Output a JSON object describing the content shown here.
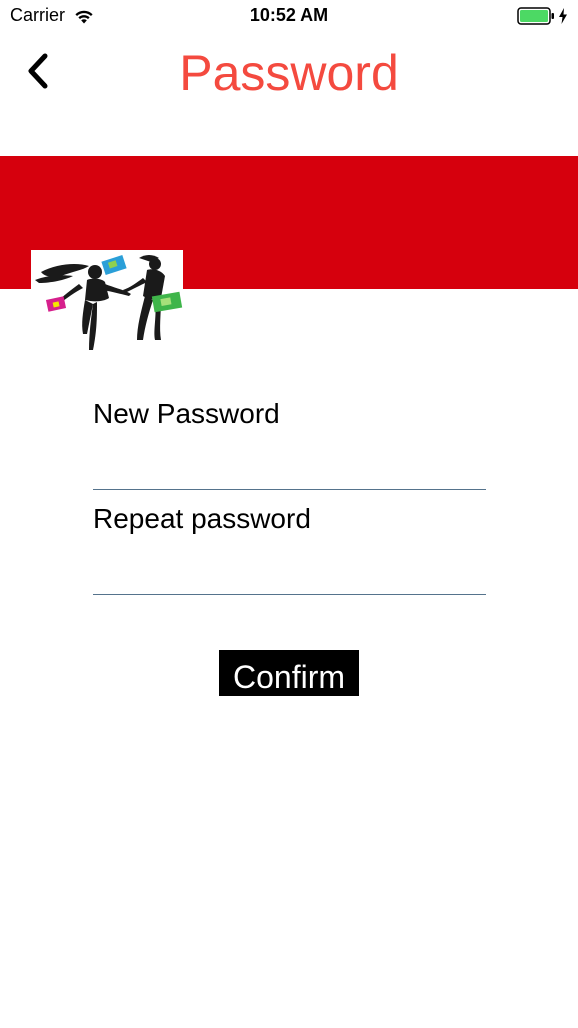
{
  "status_bar": {
    "carrier": "Carrier",
    "time": "10:52 AM"
  },
  "nav": {
    "title": "Password",
    "back_icon": "chevron-left-icon"
  },
  "colors": {
    "title": "#f44a3f",
    "banner": "#d6000d",
    "button_bg": "#000000",
    "button_text": "#ffffff",
    "input_underline": "#55738c",
    "battery": "#4cd964"
  },
  "form": {
    "new_password_label": "New Password",
    "new_password_value": "",
    "repeat_password_label": "Repeat password",
    "repeat_password_value": "",
    "confirm_label": "Confirm"
  }
}
